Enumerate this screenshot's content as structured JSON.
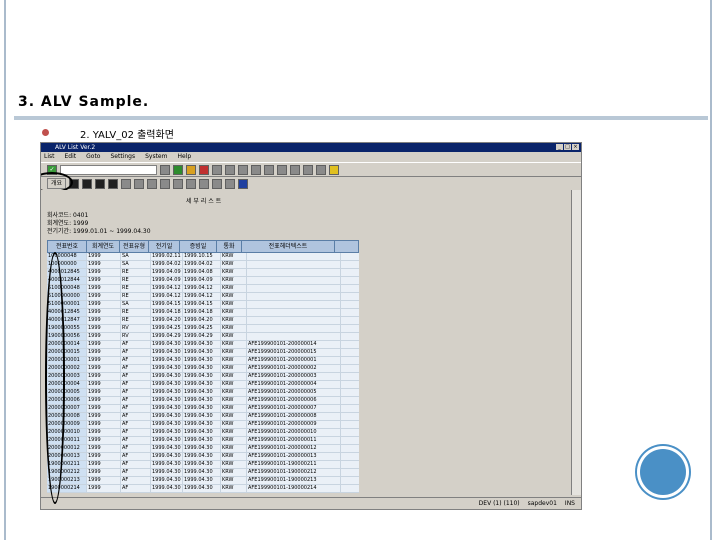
{
  "slide": {
    "title": "3. ALV Sample.",
    "bullet": "2. YALV_02 출력화면"
  },
  "sap": {
    "window_title": "ALV List Ver.2",
    "menu": [
      "List",
      "Edit",
      "Goto",
      "Settings",
      "System",
      "Help"
    ],
    "exec_label": "개요",
    "report_title": "세 부 리 스 트",
    "header_lines": [
      "회사코드: 0401",
      "회계연도: 1999",
      "전기기간: 1999.01.01 ~ 1999.04.30"
    ],
    "columns": [
      "전표번호",
      "회계연도",
      "전표유형",
      "전기일",
      "증빙일",
      "통화",
      "전표헤더텍스트"
    ],
    "rows": [
      [
        "100000048",
        "1999",
        "SA",
        "1999.02.11",
        "1999.10.15",
        "KRW",
        ""
      ],
      [
        "100000000",
        "1999",
        "SA",
        "1999.04.02",
        "1999.04.02",
        "KRW",
        ""
      ],
      [
        "4000012845",
        "1999",
        "RE",
        "1999.04.09",
        "1999.04.08",
        "KRW",
        ""
      ],
      [
        "4000012844",
        "1999",
        "RE",
        "1999.04.09",
        "1999.04.09",
        "KRW",
        ""
      ],
      [
        "5100000048",
        "1999",
        "RE",
        "1999.04.12",
        "1999.04.12",
        "KRW",
        ""
      ],
      [
        "5100000000",
        "1999",
        "RE",
        "1999.04.12",
        "1999.04.12",
        "KRW",
        ""
      ],
      [
        "5100000001",
        "1999",
        "SA",
        "1999.04.15",
        "1999.04.15",
        "KRW",
        ""
      ],
      [
        "4000012845",
        "1999",
        "RE",
        "1999.04.18",
        "1999.04.18",
        "KRW",
        ""
      ],
      [
        "4000012847",
        "1999",
        "RE",
        "1999.04.20",
        "1999.04.20",
        "KRW",
        ""
      ],
      [
        "1900000055",
        "1999",
        "RV",
        "1999.04.25",
        "1999.04.25",
        "KRW",
        ""
      ],
      [
        "1900000056",
        "1999",
        "RV",
        "1999.04.29",
        "1999.04.29",
        "KRW",
        ""
      ],
      [
        "2000000014",
        "1999",
        "AF",
        "1999.04.30",
        "1999.04.30",
        "KRW",
        "AFE199900101-200000014"
      ],
      [
        "2000000015",
        "1999",
        "AF",
        "1999.04.30",
        "1999.04.30",
        "KRW",
        "AFE199900101-200000015"
      ],
      [
        "2000000001",
        "1999",
        "AF",
        "1999.04.30",
        "1999.04.30",
        "KRW",
        "AFE199900101-200000001"
      ],
      [
        "2000000002",
        "1999",
        "AF",
        "1999.04.30",
        "1999.04.30",
        "KRW",
        "AFE199900101-200000002"
      ],
      [
        "2000000003",
        "1999",
        "AF",
        "1999.04.30",
        "1999.04.30",
        "KRW",
        "AFE199900101-200000003"
      ],
      [
        "2000000004",
        "1999",
        "AF",
        "1999.04.30",
        "1999.04.30",
        "KRW",
        "AFE199900101-200000004"
      ],
      [
        "2000000005",
        "1999",
        "AF",
        "1999.04.30",
        "1999.04.30",
        "KRW",
        "AFE199900101-200000005"
      ],
      [
        "2000000006",
        "1999",
        "AF",
        "1999.04.30",
        "1999.04.30",
        "KRW",
        "AFE199900101-200000006"
      ],
      [
        "2000000007",
        "1999",
        "AF",
        "1999.04.30",
        "1999.04.30",
        "KRW",
        "AFE199900101-200000007"
      ],
      [
        "2000000008",
        "1999",
        "AF",
        "1999.04.30",
        "1999.04.30",
        "KRW",
        "AFE199900101-200000008"
      ],
      [
        "2000000009",
        "1999",
        "AF",
        "1999.04.30",
        "1999.04.30",
        "KRW",
        "AFE199900101-200000009"
      ],
      [
        "2000000010",
        "1999",
        "AF",
        "1999.04.30",
        "1999.04.30",
        "KRW",
        "AFE199900101-200000010"
      ],
      [
        "2000000011",
        "1999",
        "AF",
        "1999.04.30",
        "1999.04.30",
        "KRW",
        "AFE199900101-200000011"
      ],
      [
        "2000000012",
        "1999",
        "AF",
        "1999.04.30",
        "1999.04.30",
        "KRW",
        "AFE199900101-200000012"
      ],
      [
        "2000000013",
        "1999",
        "AF",
        "1999.04.30",
        "1999.04.30",
        "KRW",
        "AFE199900101-200000013"
      ],
      [
        "1900000211",
        "1999",
        "AF",
        "1999.04.30",
        "1999.04.30",
        "KRW",
        "AFE199900101-190000211"
      ],
      [
        "1900000212",
        "1999",
        "AF",
        "1999.04.30",
        "1999.04.30",
        "KRW",
        "AFE199900101-190000212"
      ],
      [
        "1900000213",
        "1999",
        "AF",
        "1999.04.30",
        "1999.04.30",
        "KRW",
        "AFE199900101-190000213"
      ],
      [
        "1900000214",
        "1999",
        "AF",
        "1999.04.30",
        "1999.04.30",
        "KRW",
        "AFE199900101-190000214"
      ]
    ],
    "status": [
      "DEV (1) (110)",
      "sapdev01",
      "INS"
    ]
  },
  "colors": {
    "accent": "#4a90c6",
    "bullet": "#c0504d",
    "sap_title": "#0a246a"
  }
}
